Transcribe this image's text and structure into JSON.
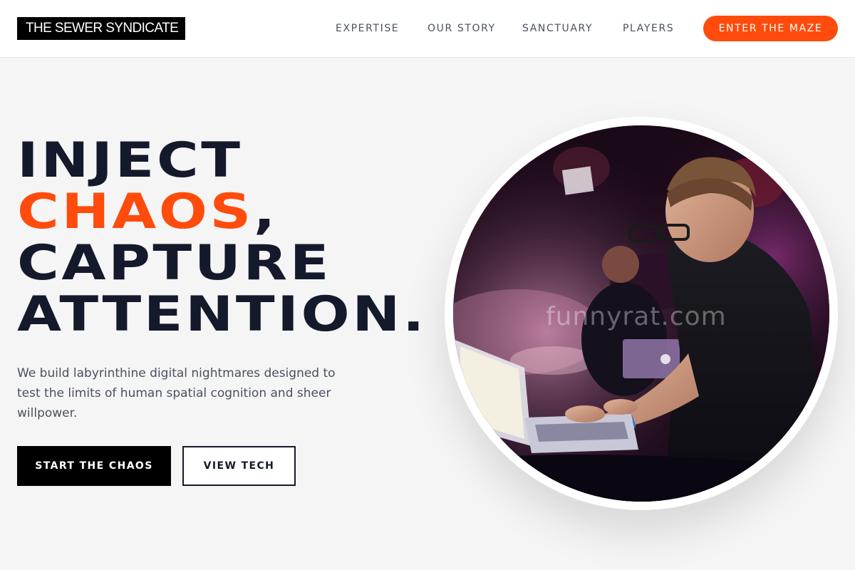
{
  "brand": {
    "name": "THE SEWER SYNDICATE"
  },
  "nav": {
    "links": [
      "EXPERTISE",
      "OUR STORY",
      "SANCTUARY",
      "PLAYERS"
    ],
    "cta_label": "ENTER THE MAZE"
  },
  "hero": {
    "headline_line1": "INJECT",
    "headline_accent": "CHAOS",
    "headline_comma": ",",
    "headline_line3": "CAPTURE",
    "headline_line4": "ATTENTION.",
    "lede": "We build labyrinthine digital nightmares designed to test the limits of human spatial cognition and sheer willpower.",
    "primary_button": "START THE CHAOS",
    "secondary_button": "VIEW TECH"
  },
  "photo": {
    "watermark": "funnyrat.com"
  },
  "colors": {
    "accent": "#ff4b0b",
    "ink": "#141a2b",
    "background": "#f5f5f5"
  }
}
